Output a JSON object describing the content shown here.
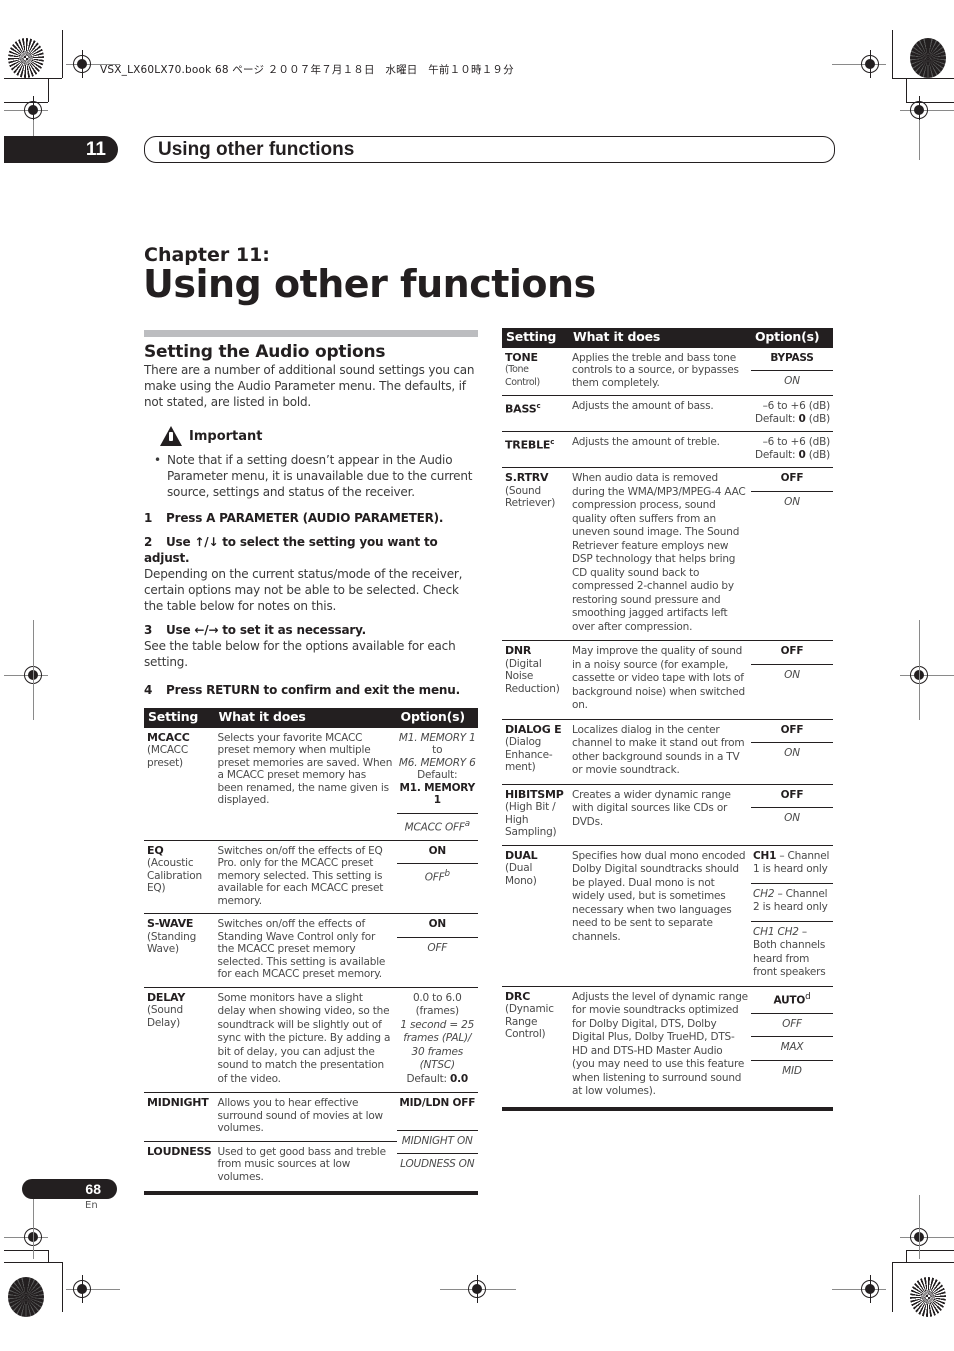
{
  "print_header": "VSX_LX60LX70.book 68 ページ ２００７年７月１８日　水曜日　午前１０時１９分",
  "chapter_tab": {
    "number": "11",
    "title": "Using other functions"
  },
  "chapter": {
    "label": "Chapter 11:",
    "title": "Using other functions"
  },
  "section": {
    "title": "Setting the Audio options",
    "intro": "There are a number of additional sound settings you can make using the Audio Parameter menu. The defaults, if not stated, are listed in bold.",
    "important_label": "Important",
    "important_note": "Note that if a setting doesn’t appear in the Audio Parameter menu, it is unavailable due to the current source, settings and status of the receiver.",
    "steps": [
      {
        "num": "1",
        "title": "Press A PARAMETER (AUDIO PARAMETER).",
        "desc": ""
      },
      {
        "num": "2",
        "title": "Use ↑/↓ to select the setting you want to adjust.",
        "desc": "Depending on the current status/mode of the receiver, certain options may not be able to be selected. Check the table below for notes on this."
      },
      {
        "num": "3",
        "title": "Use ←/→ to set it as necessary.",
        "desc": "See the table below for the options available for each setting."
      },
      {
        "num": "4",
        "title": "Press RETURN to confirm and exit the menu.",
        "desc": ""
      }
    ]
  },
  "table_headers": {
    "setting": "Setting",
    "what": "What it does",
    "options": "Option(s)"
  },
  "left_table": [
    {
      "name": "MCACC",
      "sub": "(MCACC preset)",
      "what": "Selects your favorite MCACC preset memory when multiple preset memories are saved. When a MCACC preset memory has been renamed, the name given is displayed.",
      "options": [
        "M1. MEMORY 1 to M6. MEMORY 6 Default: M1. MEMORY 1",
        "MCACC OFF"
      ],
      "opt_note": [
        "",
        "a"
      ]
    },
    {
      "name": "EQ",
      "sub": "(Acoustic Calibration EQ)",
      "what": "Switches on/off the effects of EQ Pro. only for the MCACC preset memory selected. This setting is available for each MCACC preset memory.",
      "options": [
        "ON",
        "OFF"
      ],
      "opt_note": [
        "",
        "b"
      ]
    },
    {
      "name": "S-WAVE",
      "sub": "(Standing Wave)",
      "what": "Switches on/off the effects of Standing Wave Control only for the MCACC preset memory selected. This setting is available for each MCACC preset memory.",
      "options": [
        "ON",
        "OFF"
      ]
    },
    {
      "name": "DELAY",
      "sub": "(Sound Delay)",
      "what": "Some monitors have a slight delay when showing video, so the soundtrack will be slightly out of sync with the picture. By adding a bit of delay, you can adjust the sound to match the presentation of the video.",
      "options": [
        "0.0 to 6.0 (frames) 1 second = 25 frames (PAL)/ 30 frames (NTSC) Default: 0.0"
      ]
    },
    {
      "name": "MIDNIGHT",
      "sub": "",
      "what": "Allows you to hear effective surround sound of movies at low volumes.",
      "options": [
        "MID/LDN OFF",
        "MIDNIGHT ON"
      ]
    },
    {
      "name": "LOUDNESS",
      "sub": "",
      "what": "Used to get good bass and treble from music sources at low volumes.",
      "options": [
        "LOUDNESS ON"
      ]
    }
  ],
  "left_delay_opts": {
    "range": "0.0 to 6.0",
    "unit": "(frames)",
    "note": "1 second = 25 frames (PAL)/ 30 frames (NTSC)",
    "default_label": "Default:",
    "default_value": "0.0"
  },
  "left_mcacc_opts": {
    "from": "M1. MEMORY 1",
    "to_word": "to",
    "to": "M6. MEMORY 6",
    "default_label": "Default:",
    "default_value": "M1. MEMORY 1"
  },
  "right_table": [
    {
      "name": "TONE",
      "sup": "",
      "sub": "(Tone Control)",
      "what": "Applies the treble and bass tone controls to a source, or bypasses them completely.",
      "options": [
        "BYPASS",
        "ON"
      ]
    },
    {
      "name": "BASS",
      "sup": "c",
      "sub": "",
      "what": "Adjusts the amount of bass.",
      "range": "–6 to +6 (dB)",
      "default_label": "Default:",
      "default_value": "0",
      "default_unit": "(dB)"
    },
    {
      "name": "TREBLE",
      "sup": "c",
      "sub": "",
      "what": "Adjusts the amount of treble.",
      "range": "–6 to +6 (dB)",
      "default_label": "Default:",
      "default_value": "0",
      "default_unit": "(dB)"
    },
    {
      "name": "S.RTRV",
      "sup": "",
      "sub": "(Sound Retriever)",
      "what": "When audio data is removed during the WMA/MP3/MPEG-4 AAC compression process, sound quality often suffers from an uneven sound image. The Sound Retriever feature employs new DSP technology that helps bring CD quality sound back to compressed 2-channel audio by restoring sound pressure and smoothing jagged artifacts left over after compression.",
      "options": [
        "OFF",
        "ON"
      ]
    },
    {
      "name": "DNR",
      "sup": "",
      "sub": "(Digital Noise Reduction)",
      "what": "May improve the quality of sound in a noisy source (for example, cassette or video tape with lots of background noise) when switched on.",
      "options": [
        "OFF",
        "ON"
      ]
    },
    {
      "name": "DIALOG E",
      "sup": "",
      "sub": "(Dialog Enhance-ment)",
      "what": "Localizes dialog in the center channel to make it stand out from other background sounds in a TV or movie soundtrack.",
      "options": [
        "OFF",
        "ON"
      ]
    },
    {
      "name": "HIBITSMP",
      "sup": "",
      "sub": "(High Bit / High Sampling)",
      "what": "Creates a wider dynamic range with digital sources like CDs or DVDs.",
      "options": [
        "OFF",
        "ON"
      ]
    },
    {
      "name": "DUAL",
      "sup": "",
      "sub": "(Dual Mono)",
      "what": "Specifies how dual mono encoded Dolby Digital soundtracks should be played. Dual mono is not widely used, but is sometimes necessary when two languages need to be sent to separate channels.",
      "options_detail": [
        {
          "key": "CH1",
          "desc": "– Channel 1 is heard only"
        },
        {
          "key": "CH2",
          "desc": "– Channel 2 is heard only"
        },
        {
          "key": "CH1 CH2",
          "desc": "– Both channels heard from front speakers"
        }
      ]
    },
    {
      "name": "DRC",
      "sup": "",
      "sub": "(Dynamic Range Control)",
      "what": "Adjusts the level of dynamic range for movie soundtracks optimized for Dolby Digital, DTS, Dolby Digital Plus, Dolby TrueHD, DTS-HD and DTS-HD Master Audio (you may need to use this feature when listening to surround sound at low volumes).",
      "options": [
        "AUTO",
        "OFF",
        "MAX",
        "MID"
      ],
      "opt_note": [
        "d",
        "",
        "",
        ""
      ]
    }
  ],
  "footer": {
    "page": "68",
    "lang": "En"
  }
}
